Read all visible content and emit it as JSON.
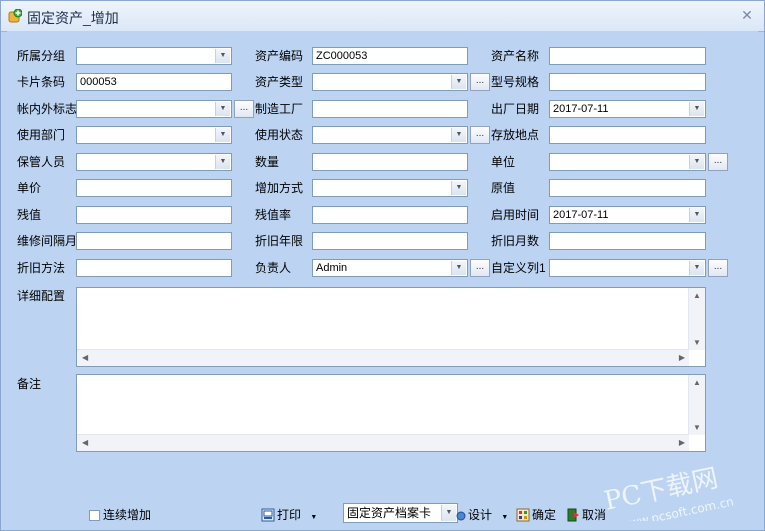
{
  "window": {
    "title": "固定资产_增加"
  },
  "fields": {
    "group": {
      "label": "所属分组",
      "value": ""
    },
    "code": {
      "label": "资产编码",
      "value": "ZC000053"
    },
    "name": {
      "label": "资产名称",
      "value": ""
    },
    "card": {
      "label": "卡片条码",
      "value": "000053"
    },
    "type": {
      "label": "资产类型",
      "value": ""
    },
    "model": {
      "label": "型号规格",
      "value": ""
    },
    "inout": {
      "label": "帐内外标志",
      "value": ""
    },
    "maker": {
      "label": "制造工厂",
      "value": ""
    },
    "madedate": {
      "label": "出厂日期",
      "value": "2017-07-11"
    },
    "dept": {
      "label": "使用部门",
      "value": ""
    },
    "status": {
      "label": "使用状态",
      "value": ""
    },
    "location": {
      "label": "存放地点",
      "value": ""
    },
    "keeper": {
      "label": "保管人员",
      "value": ""
    },
    "qty": {
      "label": "数量",
      "value": ""
    },
    "unit": {
      "label": "单位",
      "value": ""
    },
    "price": {
      "label": "单价",
      "value": ""
    },
    "addmode": {
      "label": "增加方式",
      "value": ""
    },
    "original": {
      "label": "原值",
      "value": ""
    },
    "residual": {
      "label": "残值",
      "value": ""
    },
    "resrate": {
      "label": "残值率",
      "value": ""
    },
    "startdate": {
      "label": "启用时间",
      "value": "2017-07-11"
    },
    "repair": {
      "label": "维修间隔月",
      "value": ""
    },
    "deprnyears": {
      "label": "折旧年限",
      "value": ""
    },
    "deprmonths": {
      "label": "折旧月数",
      "value": ""
    },
    "deprmethod": {
      "label": "折旧方法",
      "value": ""
    },
    "owner": {
      "label": "负责人",
      "value": "Admin"
    },
    "custom1": {
      "label": "自定义列1",
      "value": ""
    },
    "detail": {
      "label": "详细配置",
      "value": ""
    },
    "remark": {
      "label": "备注",
      "value": ""
    }
  },
  "ellipsis": "...",
  "toolbar": {
    "continuous_add": "连续增加",
    "print": "打印",
    "template": "固定资产档案卡",
    "design": "设计",
    "ok": "确定",
    "cancel": "取消"
  },
  "watermark": {
    "brand": "PC下载网",
    "url": "www.pcsoft.com.cn"
  }
}
